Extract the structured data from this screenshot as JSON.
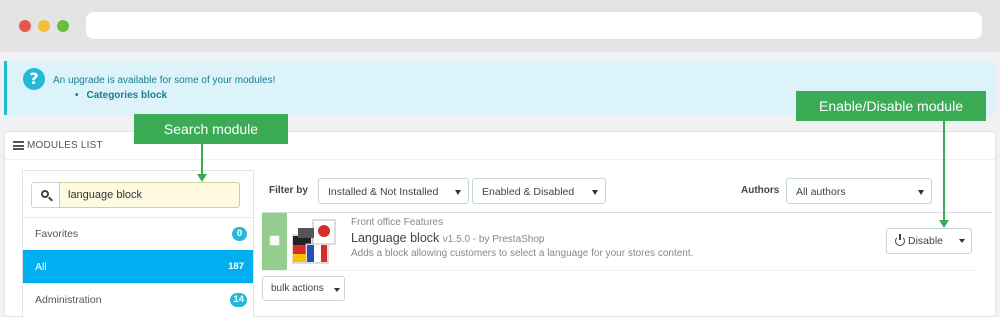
{
  "alert": {
    "message": "An upgrade is available for some of your modules!",
    "items": [
      "Categories block"
    ]
  },
  "panel": {
    "title": "MODULES LIST"
  },
  "search": {
    "value": "language block"
  },
  "categories": [
    {
      "label": "Favorites",
      "count": "0"
    },
    {
      "label": "All",
      "count": "187",
      "active": true
    },
    {
      "label": "Administration",
      "count": "14"
    }
  ],
  "filters": {
    "filter_by_label": "Filter by",
    "install_select": "Installed & Not Installed",
    "enable_select": "Enabled & Disabled",
    "authors_label": "Authors",
    "authors_select": "All authors"
  },
  "module": {
    "category": "Front office Features",
    "name": "Language block",
    "meta": "v1.5.0 - by PrestaShop",
    "description": "Adds a block allowing customers to select a language for your stores content.",
    "action_label": "Disable"
  },
  "bulk_actions_label": "bulk actions",
  "callouts": {
    "search": "Search module",
    "toggle": "Enable/Disable module"
  },
  "colors": {
    "accent": "#25b9d7",
    "active_item": "#00aff0",
    "callout": "#3bab56",
    "enabled_status": "#93ce8f"
  }
}
